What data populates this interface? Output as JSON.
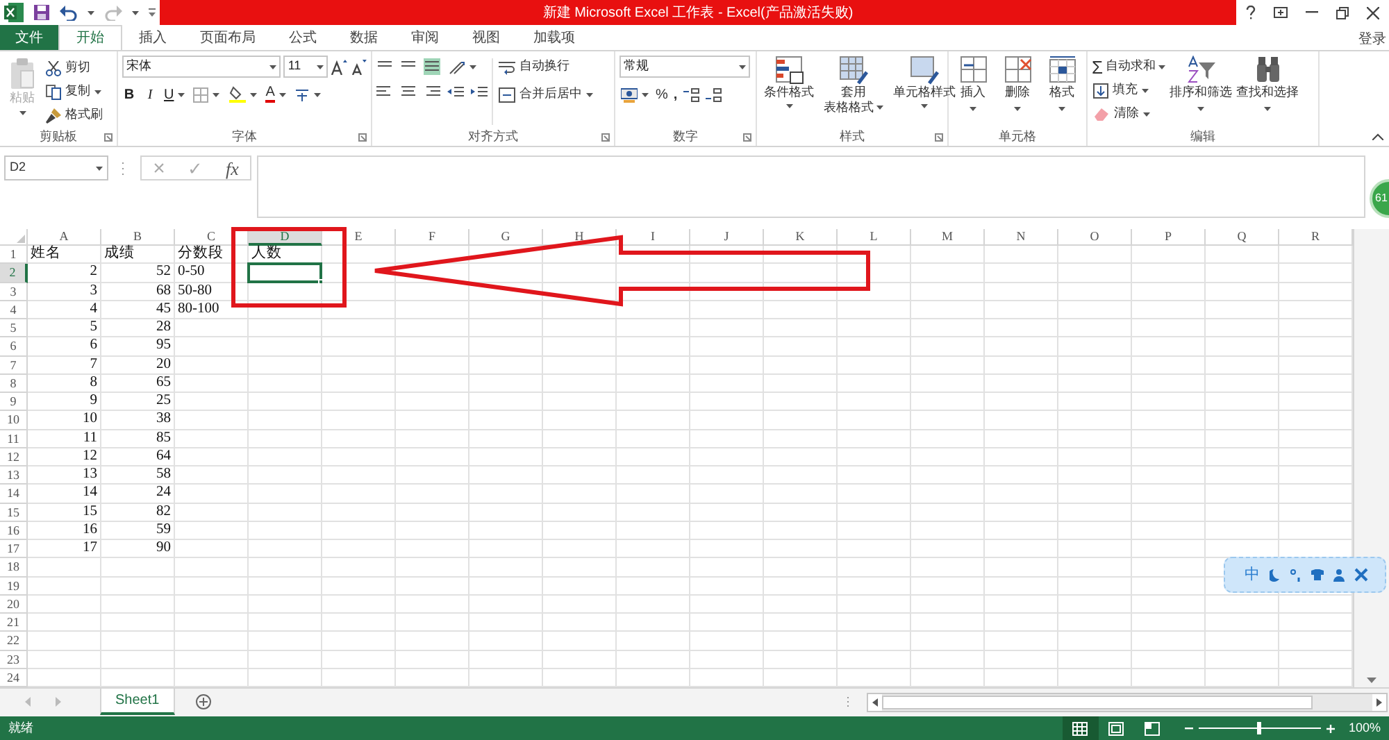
{
  "window": {
    "title": "新建 Microsoft Excel 工作表 - Excel(产品激活失败)",
    "account": "登录"
  },
  "tabs": [
    {
      "label": "文件",
      "kind": "file",
      "selected": false
    },
    {
      "label": "开始",
      "kind": "tab",
      "selected": true
    },
    {
      "label": "插入",
      "kind": "tab",
      "selected": false
    },
    {
      "label": "页面布局",
      "kind": "tab",
      "selected": false
    },
    {
      "label": "公式",
      "kind": "tab",
      "selected": false
    },
    {
      "label": "数据",
      "kind": "tab",
      "selected": false
    },
    {
      "label": "审阅",
      "kind": "tab",
      "selected": false
    },
    {
      "label": "视图",
      "kind": "tab",
      "selected": false
    },
    {
      "label": "加载项",
      "kind": "tab",
      "selected": false
    }
  ],
  "ribbon": {
    "clipboard": {
      "label": "剪贴板",
      "paste": "粘贴",
      "cut": "剪切",
      "copy": "复制",
      "format_painter": "格式刷"
    },
    "font": {
      "label": "字体",
      "font_name": "宋体",
      "font_size": "11",
      "bold": "B",
      "italic": "I",
      "underline": "U",
      "font_color": "A"
    },
    "alignment": {
      "label": "对齐方式",
      "wrap_text": "自动换行",
      "merge_center": "合并后居中"
    },
    "number": {
      "label": "数字",
      "format": "常规",
      "percent": "%",
      "comma": ","
    },
    "styles": {
      "label": "样式",
      "buttons": [
        {
          "lines": [
            "条件格式"
          ]
        },
        {
          "lines": [
            "套用",
            "表格格式"
          ]
        },
        {
          "lines": [
            "单元格样式"
          ]
        }
      ]
    },
    "cells": {
      "label": "单元格",
      "buttons": [
        "插入",
        "删除",
        "格式"
      ]
    },
    "editing": {
      "label": "编辑",
      "sigma": "Σ",
      "autosum": "自动求和",
      "fill": "填充",
      "clear": "清除",
      "sort_filter": "排序和筛选",
      "find_select": "查找和选择"
    }
  },
  "formula_bar": {
    "name_box": "D2",
    "cancel": "×",
    "enter": "✓",
    "function": "fx"
  },
  "sheet": {
    "columns": [
      {
        "label": "A",
        "selected": false
      },
      {
        "label": "B",
        "selected": false
      },
      {
        "label": "C",
        "selected": false
      },
      {
        "label": "D",
        "selected": true
      },
      {
        "label": "E",
        "selected": false
      },
      {
        "label": "F",
        "selected": false
      },
      {
        "label": "G",
        "selected": false
      },
      {
        "label": "H",
        "selected": false
      },
      {
        "label": "I",
        "selected": false
      },
      {
        "label": "J",
        "selected": false
      },
      {
        "label": "K",
        "selected": false
      },
      {
        "label": "L",
        "selected": false
      },
      {
        "label": "M",
        "selected": false
      },
      {
        "label": "N",
        "selected": false
      },
      {
        "label": "O",
        "selected": false
      },
      {
        "label": "P",
        "selected": false
      },
      {
        "label": "Q",
        "selected": false
      },
      {
        "label": "R",
        "selected": false
      }
    ],
    "rows": [
      {
        "header": "1",
        "kind": "heading",
        "selected": false,
        "cells": [
          "姓名",
          "成绩",
          "分数段",
          "人数"
        ]
      },
      {
        "header": "2",
        "kind": "data",
        "selected": true,
        "cells": [
          "2",
          "52",
          "0-50"
        ]
      },
      {
        "header": "3",
        "kind": "data",
        "selected": false,
        "cells": [
          "3",
          "68",
          "50-80"
        ]
      },
      {
        "header": "4",
        "kind": "data",
        "selected": false,
        "cells": [
          "4",
          "45",
          "80-100"
        ]
      },
      {
        "header": "5",
        "kind": "data",
        "selected": false,
        "cells": [
          "5",
          "28"
        ]
      },
      {
        "header": "6",
        "kind": "data",
        "selected": false,
        "cells": [
          "6",
          "95"
        ]
      },
      {
        "header": "7",
        "kind": "data",
        "selected": false,
        "cells": [
          "7",
          "20"
        ]
      },
      {
        "header": "8",
        "kind": "data",
        "selected": false,
        "cells": [
          "8",
          "65"
        ]
      },
      {
        "header": "9",
        "kind": "data",
        "selected": false,
        "cells": [
          "9",
          "25"
        ]
      },
      {
        "header": "10",
        "kind": "data",
        "selected": false,
        "cells": [
          "10",
          "38"
        ]
      },
      {
        "header": "11",
        "kind": "data",
        "selected": false,
        "cells": [
          "11",
          "85"
        ]
      },
      {
        "header": "12",
        "kind": "data",
        "selected": false,
        "cells": [
          "12",
          "64"
        ]
      },
      {
        "header": "13",
        "kind": "data",
        "selected": false,
        "cells": [
          "13",
          "58"
        ]
      },
      {
        "header": "14",
        "kind": "data",
        "selected": false,
        "cells": [
          "14",
          "24"
        ]
      },
      {
        "header": "15",
        "kind": "data",
        "selected": false,
        "cells": [
          "15",
          "82"
        ]
      },
      {
        "header": "16",
        "kind": "data",
        "selected": false,
        "cells": [
          "16",
          "59"
        ]
      },
      {
        "header": "17",
        "kind": "data",
        "selected": false,
        "cells": [
          "17",
          "90"
        ]
      },
      {
        "header": "18",
        "kind": "data",
        "selected": false,
        "cells": []
      },
      {
        "header": "19",
        "kind": "data",
        "selected": false,
        "cells": []
      },
      {
        "header": "20",
        "kind": "data",
        "selected": false,
        "cells": []
      },
      {
        "header": "21",
        "kind": "data",
        "selected": false,
        "cells": []
      },
      {
        "header": "22",
        "kind": "data",
        "selected": false,
        "cells": []
      },
      {
        "header": "23",
        "kind": "data",
        "selected": false,
        "cells": []
      },
      {
        "header": "24",
        "kind": "data",
        "selected": false,
        "cells": []
      }
    ]
  },
  "sheet_tabs": [
    {
      "label": "Sheet1",
      "selected": true
    }
  ],
  "status_bar": {
    "status": "就绪",
    "views": [
      {
        "selected": true
      },
      {
        "selected": false
      },
      {
        "selected": false
      }
    ],
    "zoom_slider": {
      "level": 0.5
    },
    "zoom": "100%"
  },
  "ime_toolbar": {
    "mode": "中"
  },
  "side_badge": {
    "text": "61"
  }
}
